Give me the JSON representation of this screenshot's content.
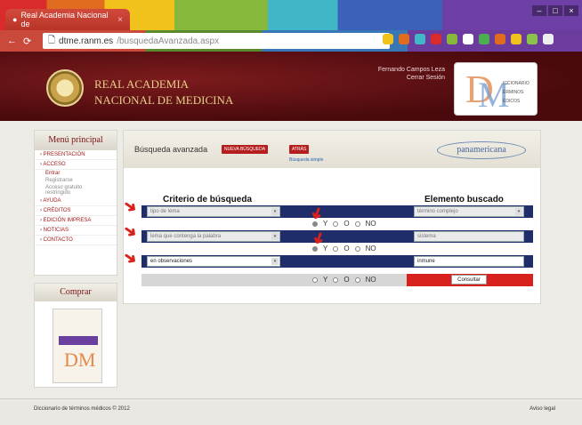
{
  "browser": {
    "tab_title": "Real Academia Nacional de",
    "url_host": "dtme.ranm.es",
    "url_path": "/busquedaAvanzada.aspx"
  },
  "header": {
    "academy_line1": "REAL ACADEMIA",
    "academy_line2": "NACIONAL DE MEDICINA",
    "user_name": "Fernando Campos Leza",
    "logout": "Cerrar Sesión"
  },
  "sidebar": {
    "title": "Menú principal",
    "items": [
      {
        "label": "› PRESENTACIÓN"
      },
      {
        "label": "› ACCESO"
      },
      {
        "label": "Entrar"
      },
      {
        "label": "Registrarse"
      },
      {
        "label": "Acceso gratuito restringido"
      },
      {
        "label": "› AYUDA"
      },
      {
        "label": "› CRÉDITOS"
      },
      {
        "label": "› EDICIÓN IMPRESA"
      },
      {
        "label": "› NOTICIAS"
      },
      {
        "label": "› CONTACTO"
      }
    ]
  },
  "buy": {
    "title": "Comprar"
  },
  "search": {
    "heading": "Búsqueda avanzada",
    "new_search": "NUEVA BÚSQUEDA",
    "back": "ATRÁS",
    "simple": "Búsqueda simple",
    "partner": "panamericana",
    "col_criteria": "Criterio de búsqueda",
    "col_element": "Elemento buscado",
    "rows": [
      {
        "criteria": "tipo de lema",
        "element": "término complejo"
      },
      {
        "criteria": "lema que contenga la palabra",
        "element": "sistema"
      },
      {
        "criteria": "en observaciones",
        "element": "inmune"
      }
    ],
    "op_y": "Y",
    "op_o": "O",
    "op_no": "NO",
    "submit": "Consultar"
  },
  "footer": {
    "copyright": "Diccionario de términos médicos © 2012",
    "legal": "Aviso legal"
  }
}
